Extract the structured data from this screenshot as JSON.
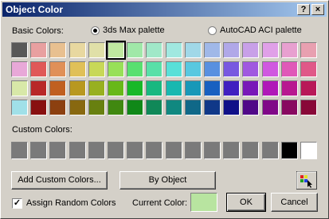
{
  "window": {
    "title": "Object Color",
    "help_glyph": "?",
    "close_glyph": "×"
  },
  "basic": {
    "label": "Basic Colors:",
    "palette_3ds": "3ds Max palette",
    "palette_acad": "AutoCAD ACI palette",
    "selected_palette": "3ds Max palette",
    "selected_swatch": "row 0, column 5",
    "rows": [
      [
        "#585858",
        "#e8a0a0",
        "#e8c090",
        "#e8d8a0",
        "#e0e0a8",
        "#c0e8a0",
        "#a0e8a8",
        "#a0e8c8",
        "#a0e8e0",
        "#a0d8e8",
        "#a0b8e8",
        "#b0a8e8",
        "#c8a0e8",
        "#e0a0e8",
        "#e8a0d0",
        "#e8a0b0"
      ],
      [
        "#e8a8d8",
        "#e05858",
        "#e09058",
        "#e0c058",
        "#c8d858",
        "#98e058",
        "#58e070",
        "#58e0a8",
        "#58e0d8",
        "#58c8e0",
        "#5890e0",
        "#7858e0",
        "#a058e0",
        "#d058e0",
        "#e058b8",
        "#e05888"
      ],
      [
        "#d8e8a8",
        "#b82828",
        "#c06020",
        "#b89820",
        "#98b020",
        "#68b818",
        "#18b828",
        "#18b880",
        "#18b8b0",
        "#1898b8",
        "#1860c0",
        "#4020c0",
        "#7818b8",
        "#b018b8",
        "#b81890",
        "#b81858"
      ],
      [
        "#a0e0e8",
        "#881010",
        "#8c4010",
        "#886810",
        "#688010",
        "#408810",
        "#108818",
        "#108858",
        "#108880",
        "#106888",
        "#103888",
        "#101088",
        "#500888",
        "#800888",
        "#880860",
        "#880838"
      ]
    ]
  },
  "custom": {
    "label": "Custom Colors:",
    "swatches": [
      "#7a7a7a",
      "#7a7a7a",
      "#7a7a7a",
      "#7a7a7a",
      "#7a7a7a",
      "#7a7a7a",
      "#7a7a7a",
      "#7a7a7a",
      "#7a7a7a",
      "#7a7a7a",
      "#7a7a7a",
      "#7a7a7a",
      "#7a7a7a",
      "#7a7a7a",
      "#000000",
      "#ffffff"
    ]
  },
  "buttons": {
    "add_custom": "Add Custom Colors...",
    "by_object": "By Object",
    "ok": "OK",
    "cancel": "Cancel"
  },
  "assign_random": {
    "label": "Assign Random Colors",
    "checked": true
  },
  "current_color": {
    "label": "Current Color:",
    "color": "#b8e4a0"
  },
  "icons": {
    "picker": "color-picker-icon"
  }
}
